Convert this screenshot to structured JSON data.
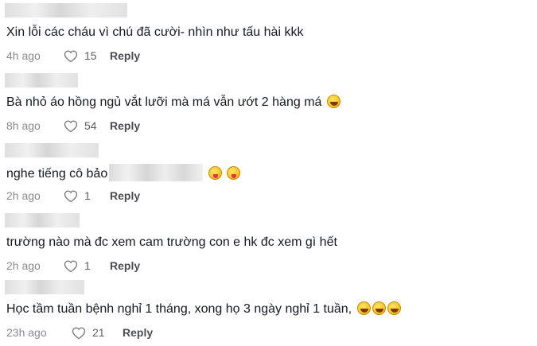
{
  "comments": [
    {
      "text": "Xin lỗi các cháu vì chú đã cười- nhìn như tấu hài kkk",
      "emojis": [],
      "time": "4h ago",
      "likes": "15",
      "reply_label": "Reply"
    },
    {
      "text": "Bà nhỏ áo hồng ngủ vắt lưỡi mà má vẫn ướt 2 hàng má",
      "emojis": [
        "laughing-face-icon"
      ],
      "time": "8h ago",
      "likes": "54",
      "reply_label": "Reply"
    },
    {
      "text": "nghe tiếng cô bảo",
      "emojis": [
        "tongue-face-icon",
        "tongue-face-icon"
      ],
      "time": "2h ago",
      "likes": "1",
      "reply_label": "Reply"
    },
    {
      "text": "trường nào mà đc xem cam trường con e hk đc xem gì hết",
      "emojis": [],
      "time": "2h ago",
      "likes": "1",
      "reply_label": "Reply"
    },
    {
      "text": "Học tầm tuần bệnh nghỉ 1 tháng, xong họ 3 ngày nghỉ 1 tuần,",
      "emojis": [
        "laughing-face-icon",
        "laughing-face-icon",
        "laughing-face-icon"
      ],
      "time": "23h ago",
      "likes": "21",
      "reply_label": "Reply"
    }
  ]
}
